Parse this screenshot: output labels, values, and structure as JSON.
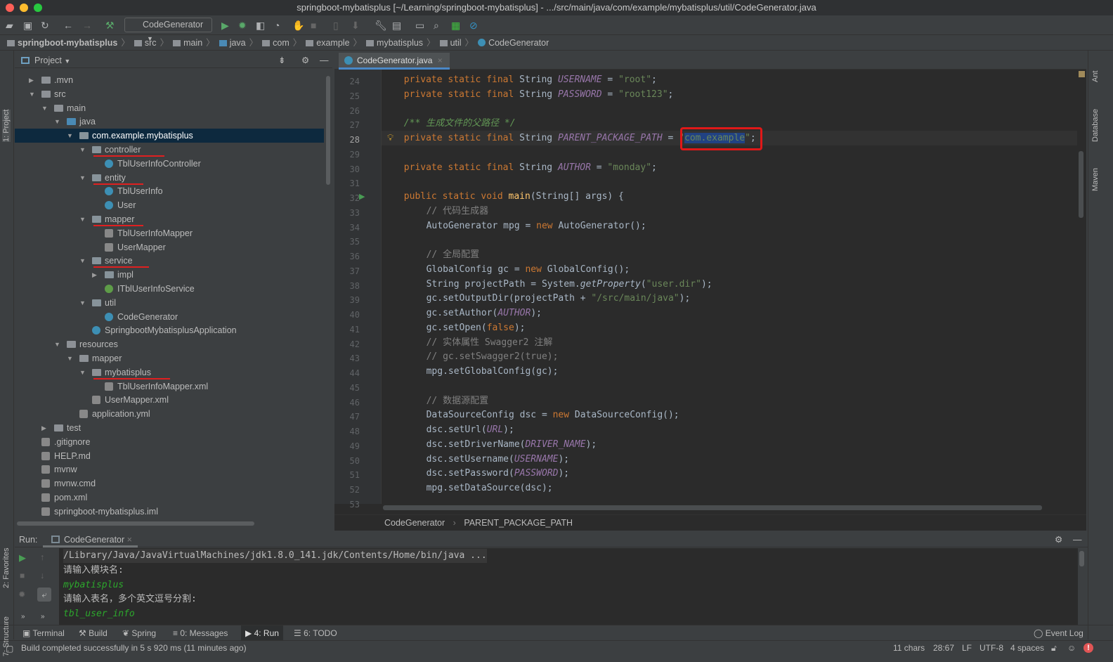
{
  "window": {
    "title": "springboot-mybatisplus [~/Learning/springboot-mybatisplus] - .../src/main/java/com/example/mybatisplus/util/CodeGenerator.java"
  },
  "toolbar": {
    "run_config": "CodeGenerator"
  },
  "breadcrumbs": [
    "springboot-mybatisplus",
    "src",
    "main",
    "java",
    "com",
    "example",
    "mybatisplus",
    "util",
    "CodeGenerator"
  ],
  "left_strip": {
    "project": "1: Project",
    "favorites": "2: Favorites",
    "structure": "7: Structure"
  },
  "right_strip": {
    "ant": "Ant",
    "database": "Database",
    "maven": "Maven"
  },
  "project_panel": {
    "title": "Project"
  },
  "tree": [
    {
      "label": ".mvn",
      "depth": 1,
      "type": "folder",
      "arrow": "collapsed"
    },
    {
      "label": "src",
      "depth": 1,
      "type": "folder",
      "arrow": "expanded"
    },
    {
      "label": "main",
      "depth": 2,
      "type": "folder",
      "arrow": "expanded"
    },
    {
      "label": "java",
      "depth": 3,
      "type": "folder",
      "arrow": "expanded"
    },
    {
      "label": "com.example.mybatisplus",
      "depth": 4,
      "type": "pkg",
      "arrow": "expanded",
      "selected": true
    },
    {
      "label": "controller",
      "depth": 5,
      "type": "pkg",
      "arrow": "expanded",
      "underline": true
    },
    {
      "label": "TblUserInfoController",
      "depth": 6,
      "type": "class"
    },
    {
      "label": "entity",
      "depth": 5,
      "type": "pkg",
      "arrow": "expanded",
      "underline": true
    },
    {
      "label": "TblUserInfo",
      "depth": 6,
      "type": "class"
    },
    {
      "label": "User",
      "depth": 6,
      "type": "class"
    },
    {
      "label": "mapper",
      "depth": 5,
      "type": "pkg",
      "arrow": "expanded",
      "underline": true
    },
    {
      "label": "TblUserInfoMapper",
      "depth": 6,
      "type": "mapper"
    },
    {
      "label": "UserMapper",
      "depth": 6,
      "type": "mapper"
    },
    {
      "label": "service",
      "depth": 5,
      "type": "pkg",
      "arrow": "expanded",
      "underline": true
    },
    {
      "label": "impl",
      "depth": 6,
      "type": "pkg",
      "arrow": "collapsed"
    },
    {
      "label": "ITblUserInfoService",
      "depth": 6,
      "type": "interface"
    },
    {
      "label": "util",
      "depth": 5,
      "type": "pkg",
      "arrow": "expanded"
    },
    {
      "label": "CodeGenerator",
      "depth": 6,
      "type": "class"
    },
    {
      "label": "SpringbootMybatisplusApplication",
      "depth": 5,
      "type": "class"
    },
    {
      "label": "resources",
      "depth": 3,
      "type": "folder",
      "arrow": "expanded"
    },
    {
      "label": "mapper",
      "depth": 4,
      "type": "folder",
      "arrow": "expanded"
    },
    {
      "label": "mybatisplus",
      "depth": 5,
      "type": "folder",
      "arrow": "expanded",
      "underline": true
    },
    {
      "label": "TblUserInfoMapper.xml",
      "depth": 6,
      "type": "mapper"
    },
    {
      "label": "UserMapper.xml",
      "depth": 5,
      "type": "mapper"
    },
    {
      "label": "application.yml",
      "depth": 4,
      "type": "file"
    },
    {
      "label": "test",
      "depth": 2,
      "type": "folder",
      "arrow": "collapsed"
    },
    {
      "label": ".gitignore",
      "depth": 1,
      "type": "file"
    },
    {
      "label": "HELP.md",
      "depth": 1,
      "type": "file"
    },
    {
      "label": "mvnw",
      "depth": 1,
      "type": "file"
    },
    {
      "label": "mvnw.cmd",
      "depth": 1,
      "type": "file"
    },
    {
      "label": "pom.xml",
      "depth": 1,
      "type": "file"
    },
    {
      "label": "springboot-mybatisplus.iml",
      "depth": 1,
      "type": "file"
    }
  ],
  "editor": {
    "tab": "CodeGenerator.java",
    "current_line": 28,
    "lines": [
      {
        "n": 24,
        "indent": 4,
        "t": [
          [
            "kw",
            "private static final "
          ],
          [
            "",
            "String "
          ],
          [
            "cst",
            "USERNAME"
          ],
          [
            "",
            " = "
          ],
          [
            "str",
            "\"root\""
          ],
          [
            "",
            ";"
          ]
        ]
      },
      {
        "n": 25,
        "indent": 4,
        "t": [
          [
            "kw",
            "private static final "
          ],
          [
            "",
            "String "
          ],
          [
            "cst",
            "PASSWORD"
          ],
          [
            "",
            " = "
          ],
          [
            "str",
            "\"root123\""
          ],
          [
            "",
            ";"
          ]
        ]
      },
      {
        "n": 26,
        "indent": 0,
        "t": []
      },
      {
        "n": 27,
        "indent": 4,
        "t": [
          [
            "doc",
            "/** 生成文件的父路径 */"
          ]
        ]
      },
      {
        "n": 28,
        "indent": 4,
        "t": [
          [
            "kw",
            "private static final "
          ],
          [
            "",
            "String "
          ],
          [
            "cst",
            "PARENT_PACKAGE_PATH"
          ],
          [
            "",
            " = "
          ],
          [
            "str",
            "\""
          ],
          [
            "str sel",
            "com.example"
          ],
          [
            "str",
            "\""
          ],
          [
            "",
            ";"
          ]
        ]
      },
      {
        "n": 29,
        "indent": 0,
        "t": []
      },
      {
        "n": 30,
        "indent": 4,
        "t": [
          [
            "kw",
            "private static final "
          ],
          [
            "",
            "String "
          ],
          [
            "cst",
            "AUTHOR"
          ],
          [
            "",
            " = "
          ],
          [
            "str",
            "\"monday\""
          ],
          [
            "",
            ";"
          ]
        ]
      },
      {
        "n": 31,
        "indent": 0,
        "t": []
      },
      {
        "n": 32,
        "indent": 4,
        "t": [
          [
            "kw",
            "public static void "
          ],
          [
            "fn",
            "main"
          ],
          [
            "",
            "(String[] args) {"
          ]
        ]
      },
      {
        "n": 33,
        "indent": 8,
        "t": [
          [
            "cmt",
            "// 代码生成器"
          ]
        ]
      },
      {
        "n": 34,
        "indent": 8,
        "t": [
          [
            "",
            "AutoGenerator mpg = "
          ],
          [
            "kw",
            "new "
          ],
          [
            "",
            "AutoGenerator();"
          ]
        ]
      },
      {
        "n": 35,
        "indent": 0,
        "t": []
      },
      {
        "n": 36,
        "indent": 8,
        "t": [
          [
            "cmt",
            "// 全局配置"
          ]
        ]
      },
      {
        "n": 37,
        "indent": 8,
        "t": [
          [
            "",
            "GlobalConfig gc = "
          ],
          [
            "kw",
            "new "
          ],
          [
            "",
            "GlobalConfig();"
          ]
        ]
      },
      {
        "n": 38,
        "indent": 8,
        "t": [
          [
            "",
            "String projectPath = System."
          ],
          [
            "it",
            "getProperty"
          ],
          [
            "",
            "("
          ],
          [
            "str",
            "\"user.dir\""
          ],
          [
            "",
            ");"
          ]
        ]
      },
      {
        "n": 39,
        "indent": 8,
        "t": [
          [
            "",
            "gc.setOutputDir(projectPath + "
          ],
          [
            "str",
            "\"/src/main/java\""
          ],
          [
            "",
            ");"
          ]
        ]
      },
      {
        "n": 40,
        "indent": 8,
        "t": [
          [
            "",
            "gc.setAuthor("
          ],
          [
            "cst",
            "AUTHOR"
          ],
          [
            "",
            ");"
          ]
        ]
      },
      {
        "n": 41,
        "indent": 8,
        "t": [
          [
            "",
            "gc.setOpen("
          ],
          [
            "kw",
            "false"
          ],
          [
            "",
            ");"
          ]
        ]
      },
      {
        "n": 42,
        "indent": 8,
        "t": [
          [
            "cmt",
            "// 实体属性 Swagger2 注解"
          ]
        ]
      },
      {
        "n": 43,
        "indent": 8,
        "t": [
          [
            "cmt",
            "// gc.setSwagger2(true);"
          ]
        ]
      },
      {
        "n": 44,
        "indent": 8,
        "t": [
          [
            "",
            "mpg.setGlobalConfig(gc);"
          ]
        ]
      },
      {
        "n": 45,
        "indent": 0,
        "t": []
      },
      {
        "n": 46,
        "indent": 8,
        "t": [
          [
            "cmt",
            "// 数据源配置"
          ]
        ]
      },
      {
        "n": 47,
        "indent": 8,
        "t": [
          [
            "",
            "DataSourceConfig dsc = "
          ],
          [
            "kw",
            "new "
          ],
          [
            "",
            "DataSourceConfig();"
          ]
        ]
      },
      {
        "n": 48,
        "indent": 8,
        "t": [
          [
            "",
            "dsc.setUrl("
          ],
          [
            "cst",
            "URL"
          ],
          [
            "",
            ");"
          ]
        ]
      },
      {
        "n": 49,
        "indent": 8,
        "t": [
          [
            "",
            "dsc.setDriverName("
          ],
          [
            "cst",
            "DRIVER_NAME"
          ],
          [
            "",
            ");"
          ]
        ]
      },
      {
        "n": 50,
        "indent": 8,
        "t": [
          [
            "",
            "dsc.setUsername("
          ],
          [
            "cst",
            "USERNAME"
          ],
          [
            "",
            ");"
          ]
        ]
      },
      {
        "n": 51,
        "indent": 8,
        "t": [
          [
            "",
            "dsc.setPassword("
          ],
          [
            "cst",
            "PASSWORD"
          ],
          [
            "",
            ");"
          ]
        ]
      },
      {
        "n": 52,
        "indent": 8,
        "t": [
          [
            "",
            "mpg.setDataSource(dsc);"
          ]
        ]
      },
      {
        "n": 53,
        "indent": 0,
        "t": []
      }
    ],
    "breadcrumb": [
      "CodeGenerator",
      "PARENT_PACKAGE_PATH"
    ]
  },
  "run": {
    "label": "Run:",
    "tab": "CodeGenerator",
    "console": [
      {
        "text": "/Library/Java/JavaVirtualMachines/jdk1.8.0_141.jdk/Contents/Home/bin/java ...",
        "kind": "cmd"
      },
      {
        "text": "请输入模块名:",
        "kind": "out"
      },
      {
        "text": "mybatisplus",
        "kind": "in"
      },
      {
        "text": "请输入表名，多个英文逗号分割:",
        "kind": "out"
      },
      {
        "text": "tbl_user_info",
        "kind": "in"
      }
    ]
  },
  "tool_windows": [
    "Terminal",
    "Build",
    "Spring",
    "0: Messages",
    "4: Run",
    "6: TODO"
  ],
  "event_log": "Event Log",
  "status": {
    "message": "Build completed successfully in 5 s 920 ms (11 minutes ago)",
    "chars": "11 chars",
    "position": "28:67",
    "line_sep": "LF",
    "encoding": "UTF-8",
    "indent": "4 spaces"
  }
}
